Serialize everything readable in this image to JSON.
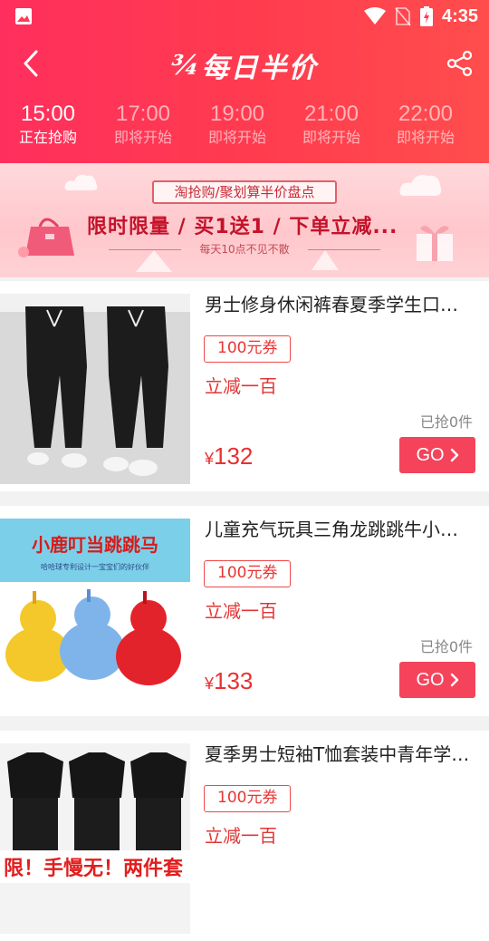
{
  "status_bar": {
    "time": "4:35"
  },
  "nav": {
    "title": "每日半价",
    "logo_mark": "¾"
  },
  "time_slots": [
    {
      "time": "15:00",
      "status": "正在抢购",
      "active": true
    },
    {
      "time": "17:00",
      "status": "即将开始",
      "active": false
    },
    {
      "time": "19:00",
      "status": "即将开始",
      "active": false
    },
    {
      "time": "21:00",
      "status": "即将开始",
      "active": false
    },
    {
      "time": "22:00",
      "status": "即将开始",
      "active": false
    }
  ],
  "banner": {
    "tag": "淘抢购/聚划算半价盘点",
    "headline": "限时限量 / 买1送1 / 下单立减...",
    "sub": "每天10点不见不散"
  },
  "products": [
    {
      "title": "男士修身休闲裤春夏季学生口袋工装九分裤",
      "coupon": "100元券",
      "desc": "立减一百",
      "sold": "已抢0件",
      "currency": "¥",
      "price": "132",
      "go": "GO"
    },
    {
      "title": "儿童充气玩具三角龙跳跳牛小鹿叮当跳跳马",
      "coupon": "100元券",
      "desc": "立减一百",
      "sold": "已抢0件",
      "currency": "¥",
      "price": "133",
      "go": "GO"
    },
    {
      "title": "夏季男士短袖T恤套装中青年学生两件套",
      "coupon": "100元券",
      "desc": "立减一百",
      "sold": "",
      "currency": "",
      "price": "",
      "go": ""
    }
  ],
  "product_images": {
    "p2_caption": "小鹿叮当跳跳马",
    "p2_subcaption": "哈哈球专利设计一宝宝们的好伙伴",
    "p3_caption": "限！手慢无！两件套"
  },
  "colors": {
    "header_start": "#ff2f5d",
    "header_end": "#ff4d4d",
    "accent": "#e83131",
    "go_button": "#f5435c"
  }
}
